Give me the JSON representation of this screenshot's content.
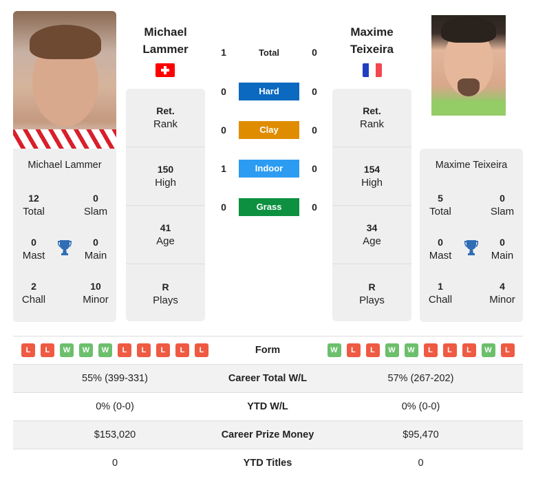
{
  "colors": {
    "hard": "#0b69bf",
    "clay": "#e08c00",
    "indoor": "#2c9cf2",
    "grass": "#0d9140",
    "win": "#6cbf6c",
    "loss": "#ef5a43",
    "trophy": "#2f6db5"
  },
  "player1": {
    "name_line1": "Michael",
    "name_line2": "Lammer",
    "full_name": "Michael Lammer",
    "flag": "switzerland-flag",
    "rank_value": "Ret.",
    "rank_label": "Rank",
    "high_value": "150",
    "high_label": "High",
    "age_value": "41",
    "age_label": "Age",
    "plays_value": "R",
    "plays_label": "Plays",
    "titles": {
      "total": "12",
      "total_label": "Total",
      "slam": "0",
      "slam_label": "Slam",
      "mast": "0",
      "mast_label": "Mast",
      "main": "0",
      "main_label": "Main",
      "chall": "2",
      "chall_label": "Chall",
      "minor": "10",
      "minor_label": "Minor"
    }
  },
  "player2": {
    "name_line1": "Maxime",
    "name_line2": "Teixeira",
    "full_name": "Maxime Teixeira",
    "flag": "france-flag",
    "rank_value": "Ret.",
    "rank_label": "Rank",
    "high_value": "154",
    "high_label": "High",
    "age_value": "34",
    "age_label": "Age",
    "plays_value": "R",
    "plays_label": "Plays",
    "titles": {
      "total": "5",
      "total_label": "Total",
      "slam": "0",
      "slam_label": "Slam",
      "mast": "0",
      "mast_label": "Mast",
      "main": "0",
      "main_label": "Main",
      "chall": "1",
      "chall_label": "Chall",
      "minor": "4",
      "minor_label": "Minor"
    }
  },
  "h2h": [
    {
      "label": "Total",
      "p1": "1",
      "p2": "0"
    },
    {
      "label": "Hard",
      "p1": "0",
      "p2": "0"
    },
    {
      "label": "Clay",
      "p1": "0",
      "p2": "0"
    },
    {
      "label": "Indoor",
      "p1": "1",
      "p2": "0"
    },
    {
      "label": "Grass",
      "p1": "0",
      "p2": "0"
    }
  ],
  "comparison": {
    "form_label": "Form",
    "p1_form": [
      "L",
      "L",
      "W",
      "W",
      "W",
      "L",
      "L",
      "L",
      "L",
      "L"
    ],
    "p2_form": [
      "W",
      "L",
      "L",
      "W",
      "W",
      "L",
      "L",
      "L",
      "W",
      "L"
    ],
    "rows": [
      {
        "label": "Career Total W/L",
        "p1": "55% (399-331)",
        "p2": "57% (267-202)"
      },
      {
        "label": "YTD W/L",
        "p1": "0% (0-0)",
        "p2": "0% (0-0)"
      },
      {
        "label": "Career Prize Money",
        "p1": "$153,020",
        "p2": "$95,470"
      },
      {
        "label": "YTD Titles",
        "p1": "0",
        "p2": "0"
      }
    ]
  }
}
